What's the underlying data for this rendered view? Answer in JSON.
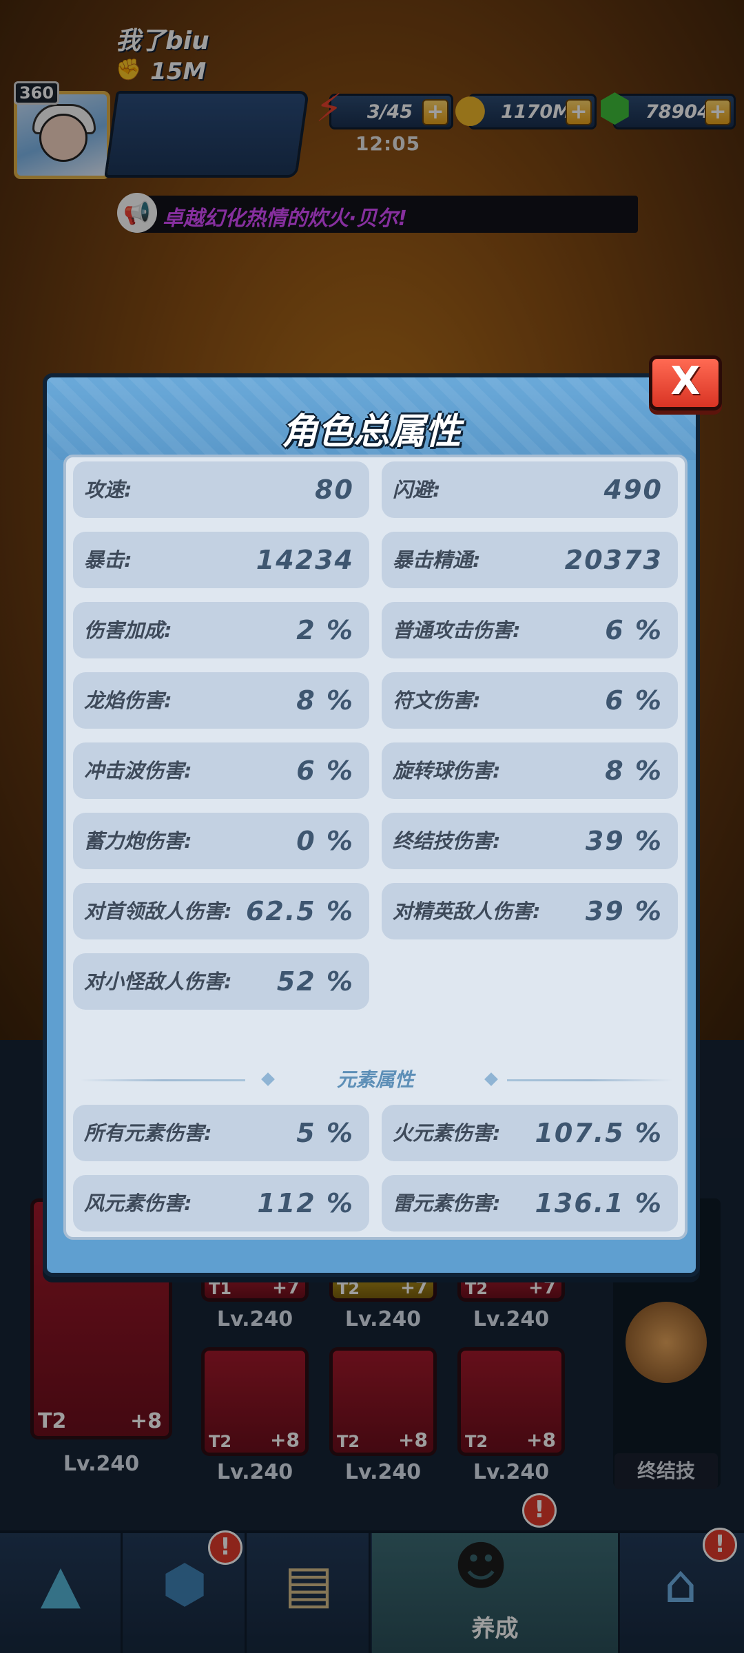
{
  "hud": {
    "level": "360",
    "player_name": "我了biu",
    "power": "15M",
    "energy": "3/45",
    "energy_timer": "12:05",
    "gold": "1170M",
    "gems": "78904",
    "plus": "+"
  },
  "broadcast": {
    "text": "卓越幻化热情的炊火·贝尔!"
  },
  "modal": {
    "title": "角色总属性",
    "close": "X",
    "stats": [
      {
        "label": "攻速:",
        "value": "80"
      },
      {
        "label": "闪避:",
        "value": "490"
      },
      {
        "label": "暴击:",
        "value": "14234"
      },
      {
        "label": "暴击精通:",
        "value": "20373"
      },
      {
        "label": "伤害加成:",
        "value": "2 %"
      },
      {
        "label": "普通攻击伤害:",
        "value": "6 %"
      },
      {
        "label": "龙焰伤害:",
        "value": "8 %"
      },
      {
        "label": "符文伤害:",
        "value": "6 %"
      },
      {
        "label": "冲击波伤害:",
        "value": "6 %"
      },
      {
        "label": "旋转球伤害:",
        "value": "8 %"
      },
      {
        "label": "蓄力炮伤害:",
        "value": "0 %"
      },
      {
        "label": "终结技伤害:",
        "value": "39 %"
      },
      {
        "label": "对首领敌人伤害:",
        "value": "62.5 %"
      },
      {
        "label": "对精英敌人伤害:",
        "value": "39 %"
      },
      {
        "label": "对小怪敌人伤害:",
        "value": "52 %"
      }
    ],
    "element_section_title": "元素属性",
    "element_stats": [
      {
        "label": "所有元素伤害:",
        "value": "5 %"
      },
      {
        "label": "火元素伤害:",
        "value": "107.5 %"
      },
      {
        "label": "风元素伤害:",
        "value": "112 %"
      },
      {
        "label": "雷元素伤害:",
        "value": "136.1 %"
      }
    ]
  },
  "equipment": {
    "main_tier": "T2",
    "main_bonus": "+8",
    "main_level": "Lv.240",
    "items": [
      {
        "tier": "T1",
        "bonus": "+7",
        "level": "Lv.240"
      },
      {
        "tier": "T2",
        "bonus": "+7",
        "level": "Lv.240"
      },
      {
        "tier": "T2",
        "bonus": "+7",
        "level": "Lv.240"
      },
      {
        "tier": "T2",
        "bonus": "+8",
        "level": "Lv.240"
      },
      {
        "tier": "T2",
        "bonus": "+8",
        "level": "Lv.240"
      },
      {
        "tier": "T2",
        "bonus": "+8",
        "level": "Lv.240"
      }
    ],
    "ult_button": "终结技"
  },
  "nav": {
    "active_label": "养成",
    "badge": "!"
  }
}
